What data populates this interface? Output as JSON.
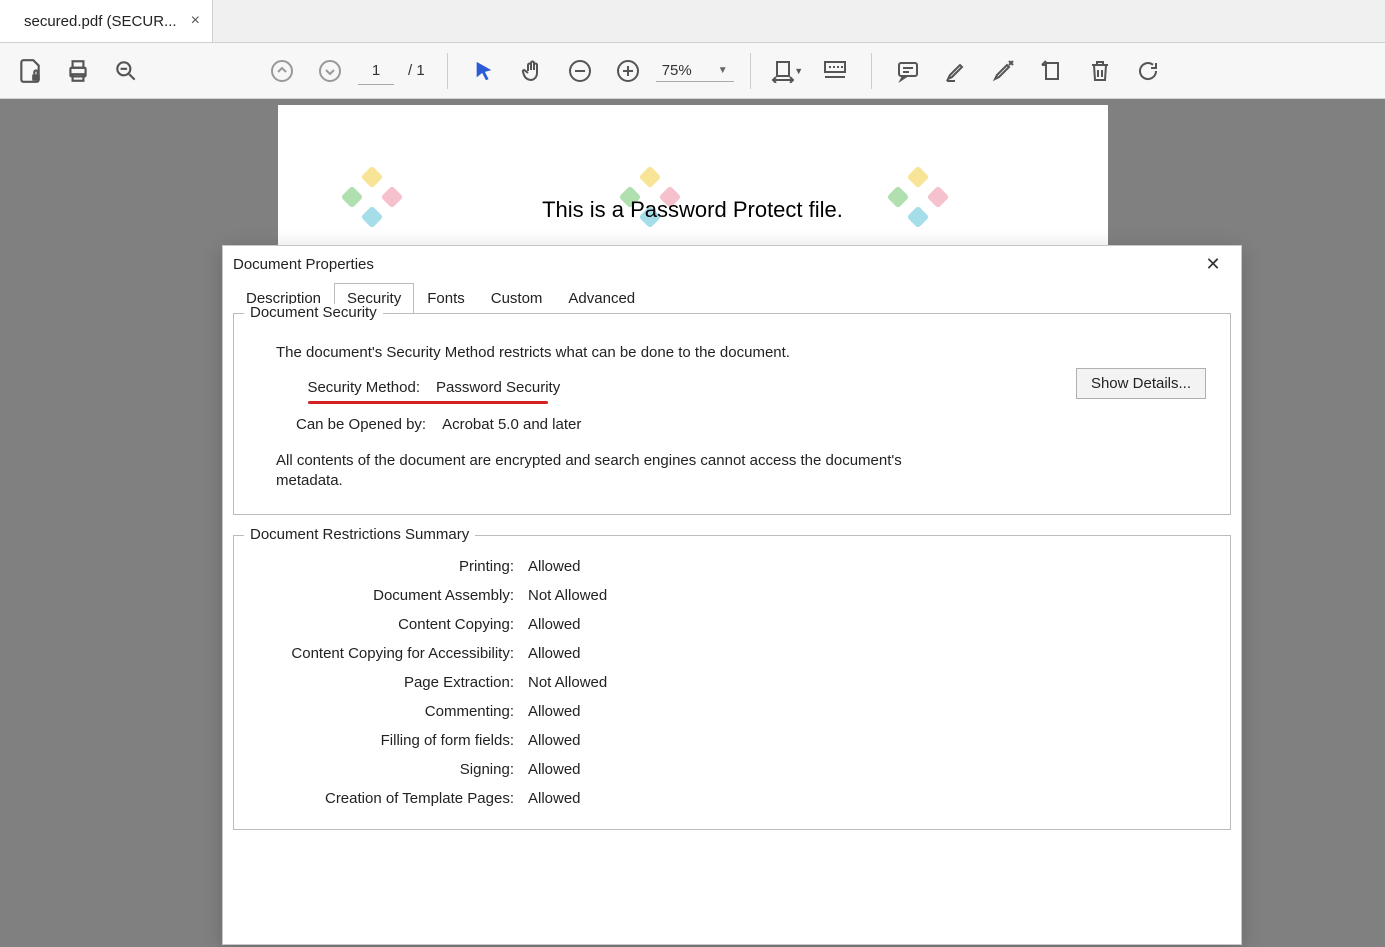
{
  "tab": {
    "title": "secured.pdf (SECUR..."
  },
  "toolbar": {
    "page_current": "1",
    "page_total": "/ 1",
    "zoom": "75%"
  },
  "document": {
    "body_text": "This is a Password Protect file."
  },
  "dialog": {
    "title": "Document Properties",
    "tabs": [
      "Description",
      "Security",
      "Fonts",
      "Custom",
      "Advanced"
    ],
    "security": {
      "legend": "Document Security",
      "description": "The document's Security Method restricts what can be done to the document.",
      "method_label": "Security Method:",
      "method_value": "Password Security",
      "opened_label": "Can be Opened by:",
      "opened_value": "Acrobat 5.0 and later",
      "note": "All contents of the document are encrypted and search engines cannot access the document's metadata.",
      "show_details": "Show Details..."
    },
    "restrictions": {
      "legend": "Document Restrictions Summary",
      "rows": [
        {
          "label": "Printing:",
          "value": "Allowed"
        },
        {
          "label": "Document Assembly:",
          "value": "Not Allowed"
        },
        {
          "label": "Content Copying:",
          "value": "Allowed"
        },
        {
          "label": "Content Copying for Accessibility:",
          "value": "Allowed"
        },
        {
          "label": "Page Extraction:",
          "value": "Not Allowed"
        },
        {
          "label": "Commenting:",
          "value": "Allowed"
        },
        {
          "label": "Filling of form fields:",
          "value": "Allowed"
        },
        {
          "label": "Signing:",
          "value": "Allowed"
        },
        {
          "label": "Creation of Template Pages:",
          "value": "Allowed"
        }
      ]
    }
  }
}
